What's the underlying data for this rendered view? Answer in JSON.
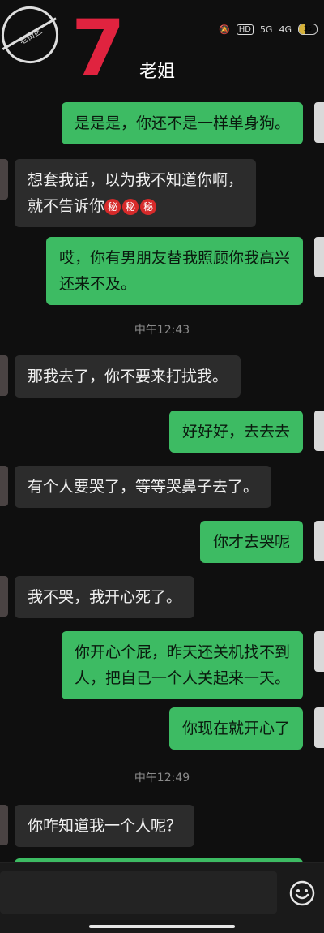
{
  "status_bar": {
    "hd": "HD",
    "net1": "5G",
    "net2": "4G",
    "battery": "35"
  },
  "watermark": {
    "text": "老街区"
  },
  "header": {
    "contact_number": "7",
    "contact_name": "老姐"
  },
  "messages": [
    {
      "side": "out",
      "text": "是是是，你还不是一样单身狗。"
    },
    {
      "side": "in",
      "line1": "想套我话，以为我不知道你啊，",
      "line2": "就不告诉你",
      "emoji": "秘"
    },
    {
      "side": "out",
      "line1": "哎，你有男朋友替我照顾你我高兴",
      "line2": "还来不及。"
    },
    {
      "side": "time",
      "text": "中午12:43"
    },
    {
      "side": "in",
      "text": "那我去了，你不要来打扰我。"
    },
    {
      "side": "out",
      "text": "好好好，去去去"
    },
    {
      "side": "in",
      "text": "有个人要哭了，等等哭鼻子去了。"
    },
    {
      "side": "out",
      "text": "你才去哭呢"
    },
    {
      "side": "in",
      "text": "我不哭，我开心死了。"
    },
    {
      "side": "out",
      "line1": "你开心个屁，昨天还关机找不到",
      "line2": "人，把自己一个人关起来一天。"
    },
    {
      "side": "out",
      "text": "你现在就开心了"
    },
    {
      "side": "time",
      "text": "中午12:49"
    },
    {
      "side": "in",
      "text": "你咋知道我一个人呢？"
    }
  ],
  "input": {
    "emoji_icon": "smiley-icon"
  },
  "colors": {
    "background": "#0f0f0f",
    "incoming": "#2c2c2c",
    "outgoing": "#3dbb63",
    "accent_red": "#e0233f"
  }
}
